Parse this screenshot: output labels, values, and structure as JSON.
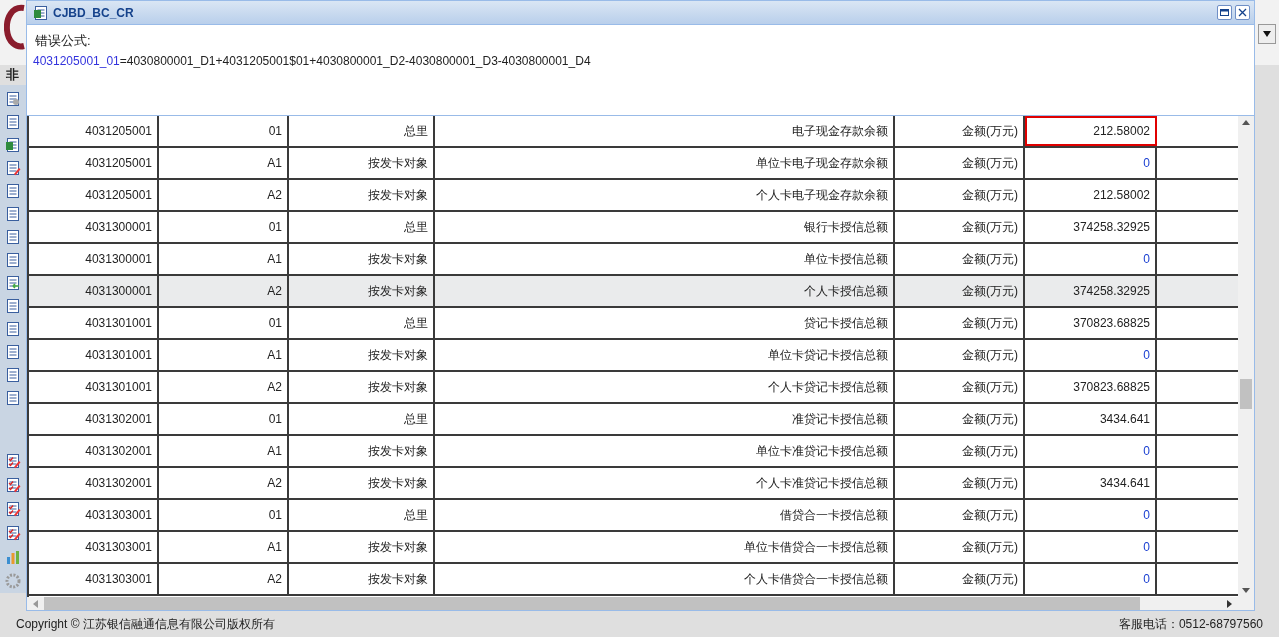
{
  "background": {
    "sidebar_title": "非",
    "footer_left": "Copyright © 江苏银信融通信息有限公司版权所有",
    "footer_right": "客服电话：0512-68797560"
  },
  "dialog": {
    "title": "CJBD_BC_CR",
    "error_label": "错误公式:",
    "formula": {
      "target": "4031205001_01",
      "expression": "=4030800001_D1+4031205001$01+4030800001_D2-4030800001_D3-4030800001_D4"
    }
  },
  "table": {
    "rows": [
      {
        "code": "4031205001",
        "sub": "01",
        "object": "总里",
        "item": "电子现金存款余额",
        "unit": "金额(万元)",
        "value": "212.58002",
        "kind": "number",
        "error": true,
        "selected": false
      },
      {
        "code": "4031205001",
        "sub": "A1",
        "object": "按发卡对象",
        "item": "单位卡电子现金存款余额",
        "unit": "金额(万元)",
        "value": "0",
        "kind": "zero",
        "error": false,
        "selected": false
      },
      {
        "code": "4031205001",
        "sub": "A2",
        "object": "按发卡对象",
        "item": "个人卡电子现金存款余额",
        "unit": "金额(万元)",
        "value": "212.58002",
        "kind": "number",
        "error": false,
        "selected": false
      },
      {
        "code": "4031300001",
        "sub": "01",
        "object": "总里",
        "item": "银行卡授信总额",
        "unit": "金额(万元)",
        "value": "374258.32925",
        "kind": "number",
        "error": false,
        "selected": false
      },
      {
        "code": "4031300001",
        "sub": "A1",
        "object": "按发卡对象",
        "item": "单位卡授信总额",
        "unit": "金额(万元)",
        "value": "0",
        "kind": "zero",
        "error": false,
        "selected": false
      },
      {
        "code": "4031300001",
        "sub": "A2",
        "object": "按发卡对象",
        "item": "个人卡授信总额",
        "unit": "金额(万元)",
        "value": "374258.32925",
        "kind": "number",
        "error": false,
        "selected": true
      },
      {
        "code": "4031301001",
        "sub": "01",
        "object": "总里",
        "item": "贷记卡授信总额",
        "unit": "金额(万元)",
        "value": "370823.68825",
        "kind": "number",
        "error": false,
        "selected": false
      },
      {
        "code": "4031301001",
        "sub": "A1",
        "object": "按发卡对象",
        "item": "单位卡贷记卡授信总额",
        "unit": "金额(万元)",
        "value": "0",
        "kind": "zero",
        "error": false,
        "selected": false
      },
      {
        "code": "4031301001",
        "sub": "A2",
        "object": "按发卡对象",
        "item": "个人卡贷记卡授信总额",
        "unit": "金额(万元)",
        "value": "370823.68825",
        "kind": "number",
        "error": false,
        "selected": false
      },
      {
        "code": "4031302001",
        "sub": "01",
        "object": "总里",
        "item": "准贷记卡授信总额",
        "unit": "金额(万元)",
        "value": "3434.641",
        "kind": "number",
        "error": false,
        "selected": false
      },
      {
        "code": "4031302001",
        "sub": "A1",
        "object": "按发卡对象",
        "item": "单位卡准贷记卡授信总额",
        "unit": "金额(万元)",
        "value": "0",
        "kind": "zero",
        "error": false,
        "selected": false
      },
      {
        "code": "4031302001",
        "sub": "A2",
        "object": "按发卡对象",
        "item": "个人卡准贷记卡授信总额",
        "unit": "金额(万元)",
        "value": "3434.641",
        "kind": "number",
        "error": false,
        "selected": false
      },
      {
        "code": "4031303001",
        "sub": "01",
        "object": "总里",
        "item": "借贷合一卡授信总额",
        "unit": "金额(万元)",
        "value": "0",
        "kind": "zero",
        "error": false,
        "selected": false
      },
      {
        "code": "4031303001",
        "sub": "A1",
        "object": "按发卡对象",
        "item": "单位卡借贷合一卡授信总额",
        "unit": "金额(万元)",
        "value": "0",
        "kind": "zero",
        "error": false,
        "selected": false
      },
      {
        "code": "4031303001",
        "sub": "A2",
        "object": "按发卡对象",
        "item": "个人卡借贷合一卡授信总额",
        "unit": "金额(万元)",
        "value": "0",
        "kind": "zero",
        "error": false,
        "selected": false
      }
    ]
  }
}
